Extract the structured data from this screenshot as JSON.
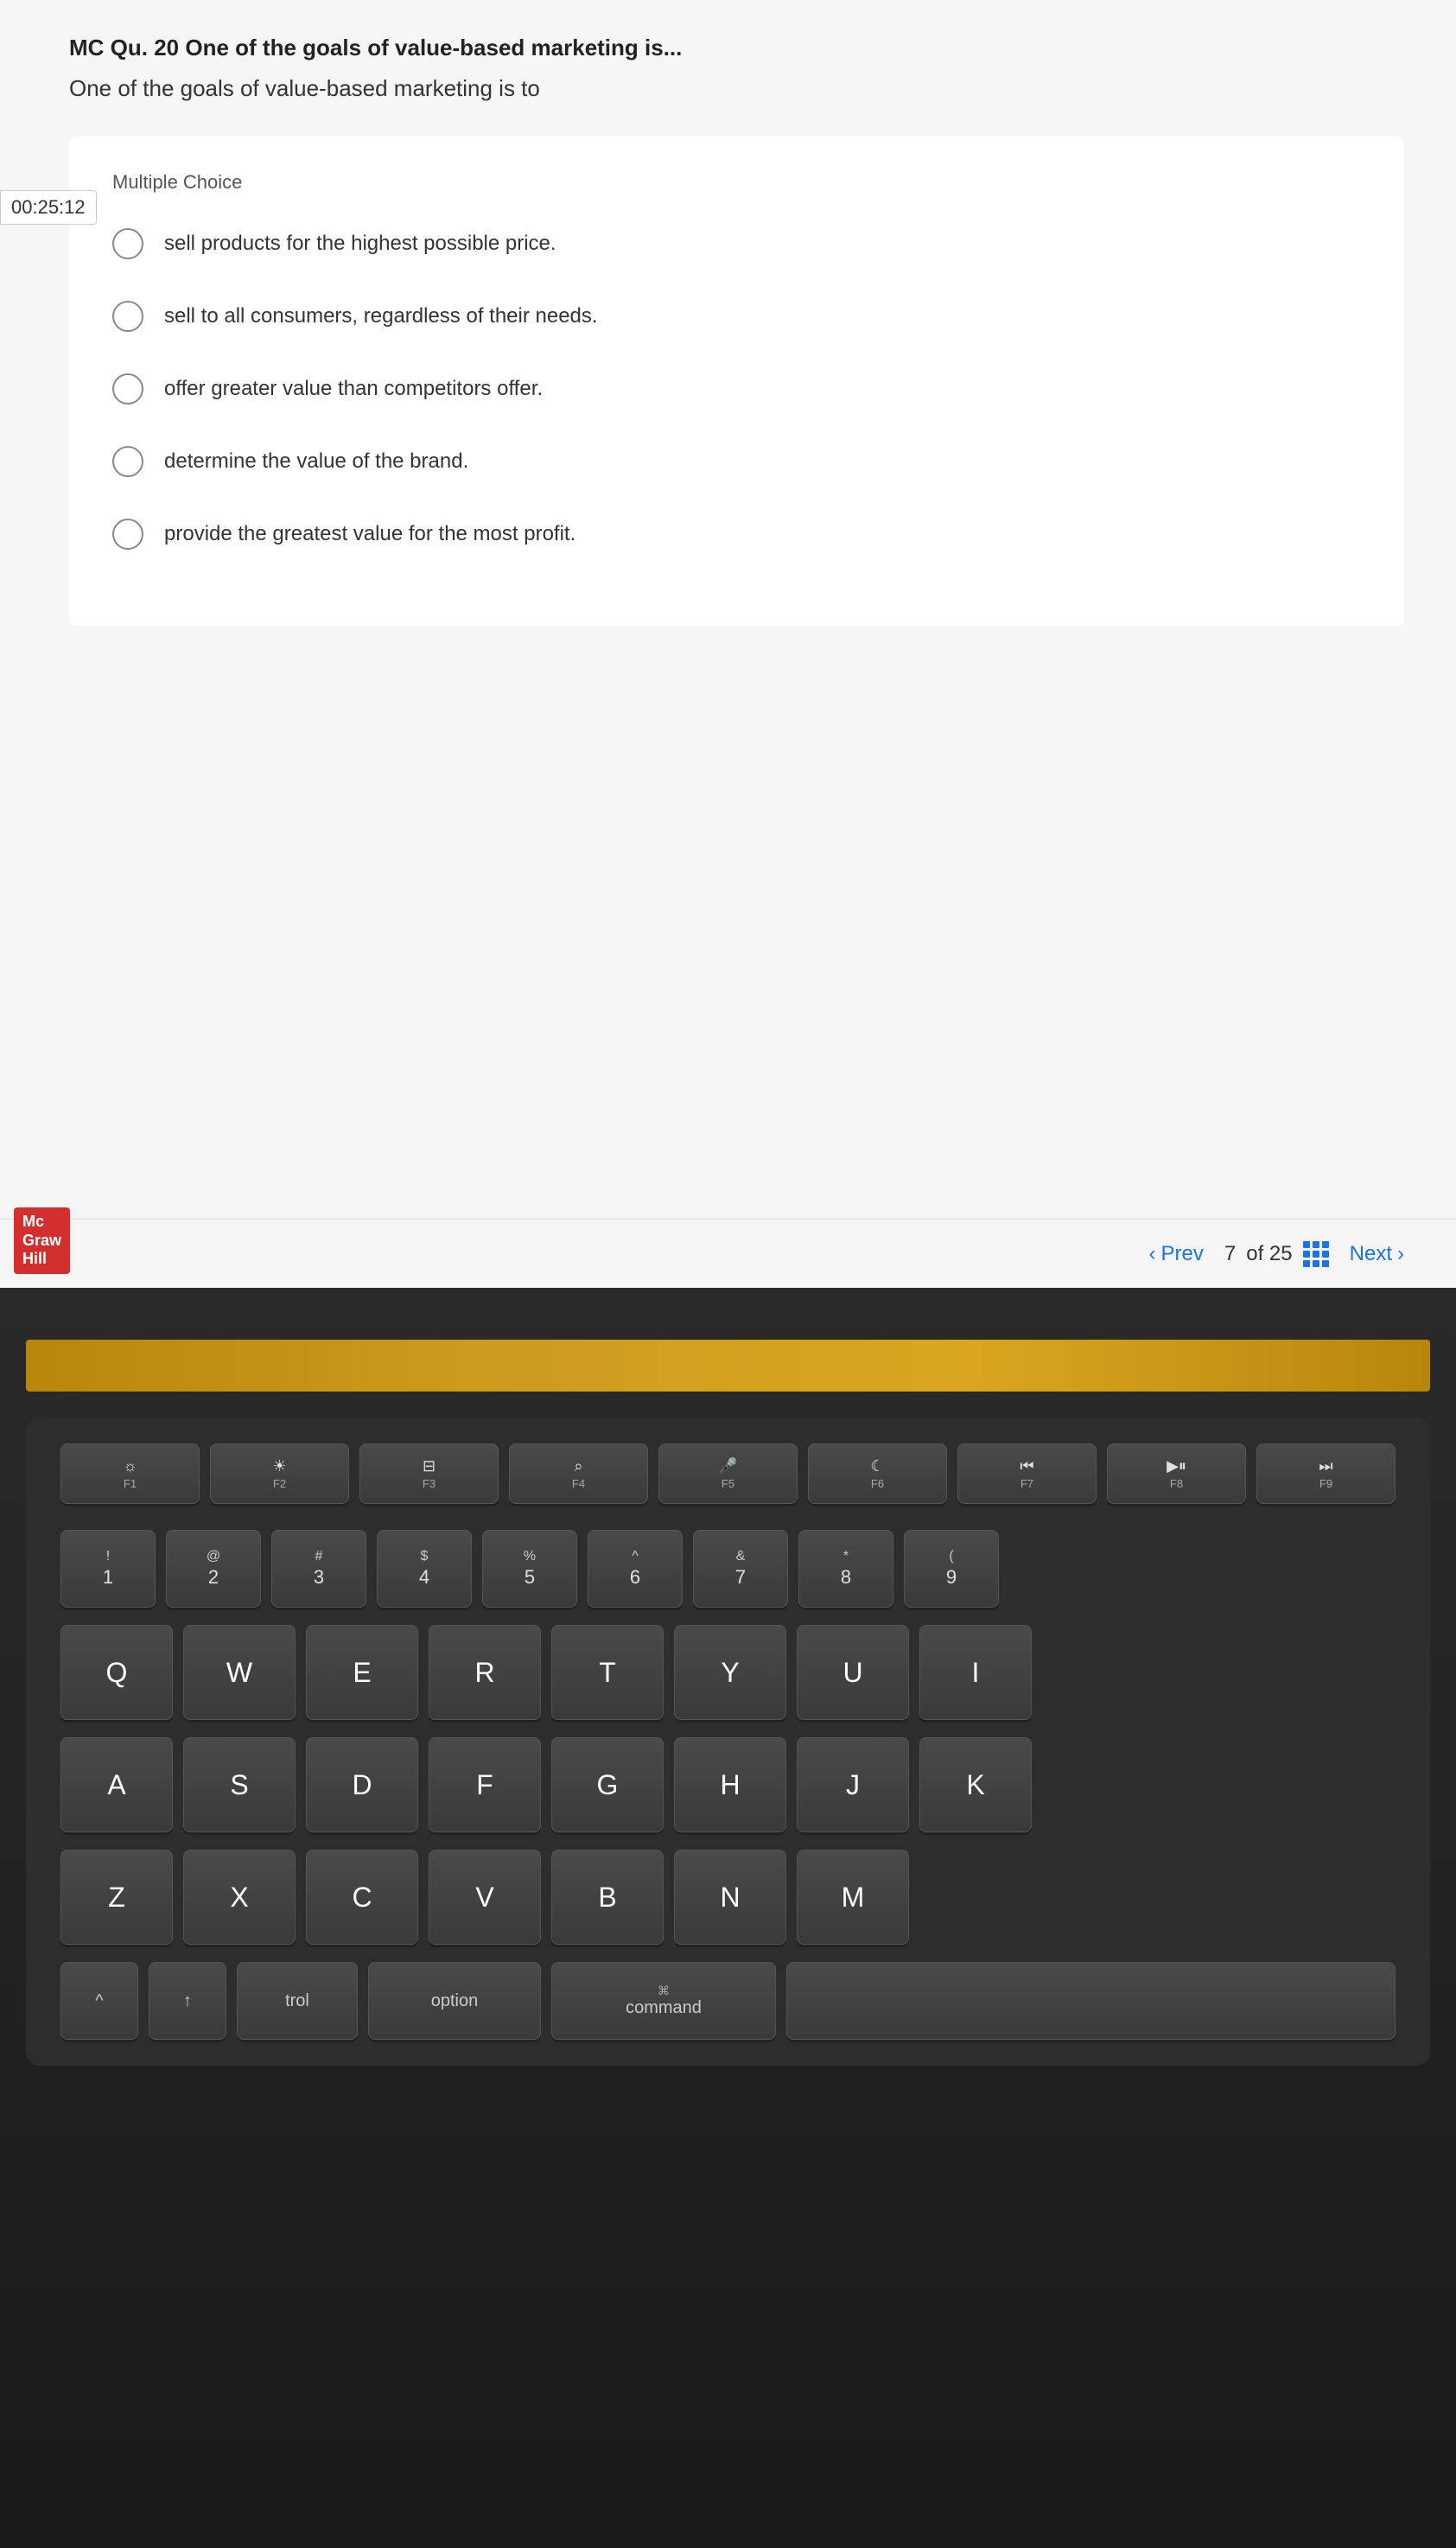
{
  "quiz": {
    "question_number": "MC Qu. 20 One of the goals of value-based marketing is...",
    "question_text": "One of the goals of value-based marketing is to",
    "timer": "00:25:12",
    "answer_type": "Multiple Choice",
    "options": [
      "sell products for the highest possible price.",
      "sell to all consumers, regardless of their needs.",
      "offer greater value than competitors offer.",
      "determine the value of the brand.",
      "provide the greatest value for the most profit."
    ],
    "navigation": {
      "prev_label": "Prev",
      "current": "7",
      "total": "of 25",
      "next_label": "Next"
    },
    "logo_line1": "Mc",
    "logo_line2": "Graw",
    "logo_line3": "Hill"
  },
  "keyboard": {
    "fn_keys": [
      {
        "icon": "☀",
        "label": "F1"
      },
      {
        "icon": "☀",
        "label": "F2"
      },
      {
        "icon": "⊞",
        "label": "F3"
      },
      {
        "icon": "🔍",
        "label": "F4"
      },
      {
        "icon": "🎤",
        "label": "F5"
      },
      {
        "icon": "☾",
        "label": "F6"
      },
      {
        "icon": "⏮",
        "label": "F7"
      },
      {
        "icon": "▶⏸",
        "label": "F8"
      },
      {
        "icon": "⏭",
        "label": "F9"
      }
    ],
    "num_row": [
      {
        "top": "!",
        "main": "1"
      },
      {
        "top": "@",
        "main": "2"
      },
      {
        "top": "#",
        "main": "3"
      },
      {
        "top": "$",
        "main": "4"
      },
      {
        "top": "%",
        "main": "5"
      },
      {
        "top": "^",
        "main": "6"
      },
      {
        "top": "&",
        "main": "7"
      },
      {
        "top": "*",
        "main": "8"
      },
      {
        "top": "(",
        "main": "9"
      }
    ],
    "row_q": [
      "Q",
      "W",
      "E",
      "R",
      "T",
      "Y",
      "U",
      "I"
    ],
    "row_a": [
      "A",
      "S",
      "D",
      "F",
      "G",
      "H",
      "J",
      "K"
    ],
    "row_z": [
      "Z",
      "X",
      "C",
      "V",
      "B",
      "N",
      "M"
    ],
    "modifiers": {
      "shift": "⇧",
      "up_arrow": "↑",
      "ctrl": "trol",
      "option": "option",
      "command_icon": "⌘",
      "command": "command"
    }
  }
}
